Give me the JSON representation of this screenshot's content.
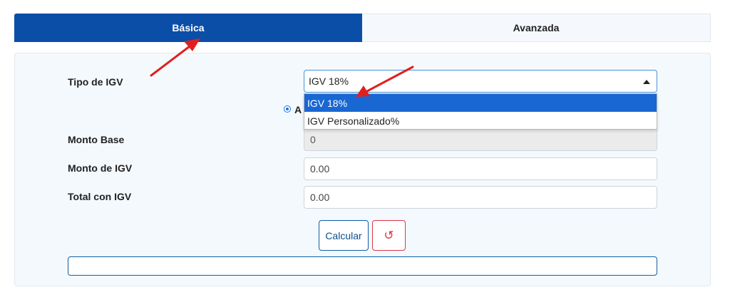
{
  "tabs": {
    "basic": "Básica",
    "advanced": "Avanzada"
  },
  "form": {
    "igv_type_label": "Tipo de IGV",
    "igv_type_value": "IGV 18%",
    "igv_options": [
      "IGV 18%",
      "IGV Personalizado%"
    ],
    "radio_label_visible": "A",
    "base_amount_label": "Monto Base",
    "base_amount_value": "0",
    "igv_amount_label": "Monto de IGV",
    "igv_amount_value": "0.00",
    "total_label": "Total con IGV",
    "total_value": "0.00"
  },
  "buttons": {
    "calculate": "Calcular",
    "reset_glyph": "↺"
  },
  "colors": {
    "active_tab": "#0b4ea8",
    "selected_option": "#1967d2",
    "annotation_arrow": "#e02020",
    "reset": "#dc3545"
  }
}
